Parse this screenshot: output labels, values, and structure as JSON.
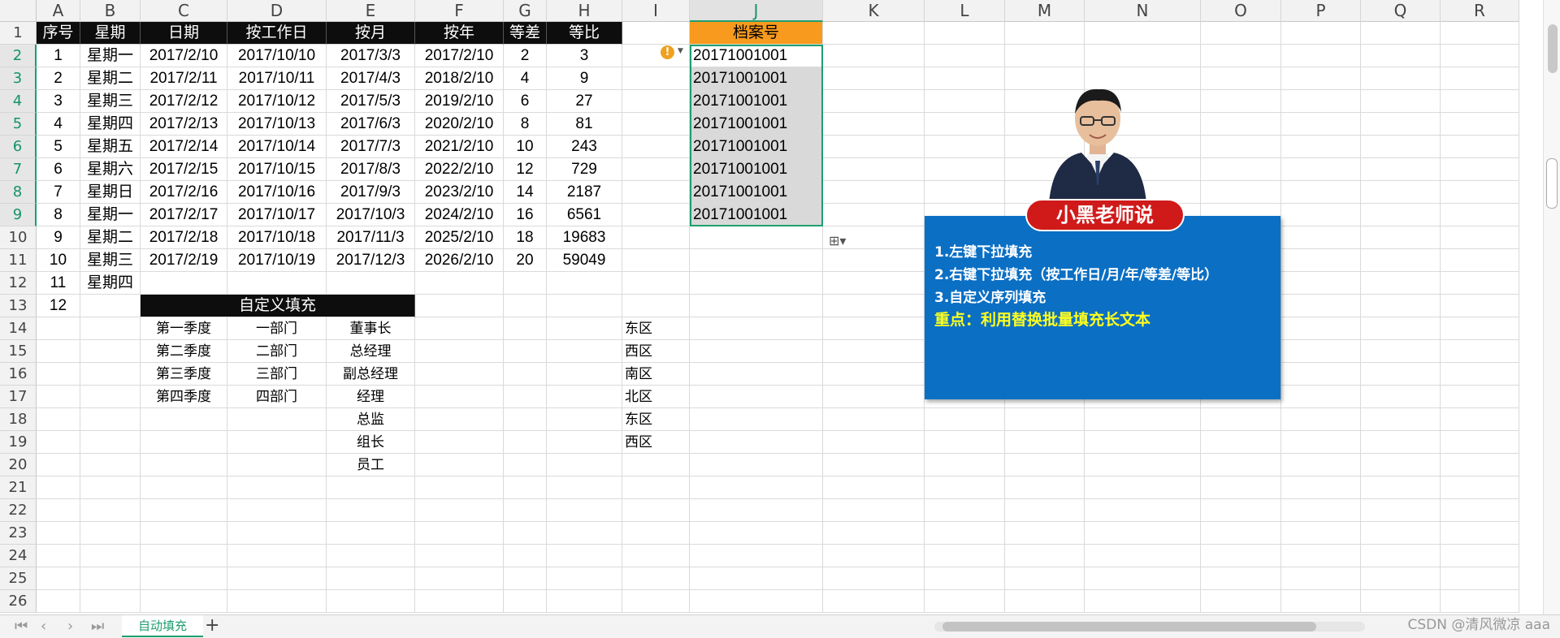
{
  "columns": [
    "A",
    "B",
    "C",
    "D",
    "E",
    "F",
    "G",
    "H",
    "I",
    "J",
    "K",
    "L",
    "M",
    "N",
    "O",
    "P",
    "Q",
    "R"
  ],
  "selected_column": "J",
  "rows": [
    "1",
    "2",
    "3",
    "4",
    "5",
    "6",
    "7",
    "8",
    "9",
    "10",
    "11",
    "12",
    "13",
    "14",
    "15",
    "16",
    "17",
    "18",
    "19",
    "20",
    "21",
    "22",
    "23",
    "24",
    "25",
    "26"
  ],
  "selected_rows": [
    "2",
    "3",
    "4",
    "5",
    "6",
    "7",
    "8",
    "9"
  ],
  "header_row": [
    "序号",
    "星期",
    "日期",
    "按工作日",
    "按月",
    "按年",
    "等差",
    "等比"
  ],
  "j_header": "档案号",
  "table_rows": [
    [
      "1",
      "星期一",
      "2017/2/10",
      "2017/10/10",
      "2017/3/3",
      "2017/2/10",
      "2",
      "3"
    ],
    [
      "2",
      "星期二",
      "2017/2/11",
      "2017/10/11",
      "2017/4/3",
      "2018/2/10",
      "4",
      "9"
    ],
    [
      "3",
      "星期三",
      "2017/2/12",
      "2017/10/12",
      "2017/5/3",
      "2019/2/10",
      "6",
      "27"
    ],
    [
      "4",
      "星期四",
      "2017/2/13",
      "2017/10/13",
      "2017/6/3",
      "2020/2/10",
      "8",
      "81"
    ],
    [
      "5",
      "星期五",
      "2017/2/14",
      "2017/10/14",
      "2017/7/3",
      "2021/2/10",
      "10",
      "243"
    ],
    [
      "6",
      "星期六",
      "2017/2/15",
      "2017/10/15",
      "2017/8/3",
      "2022/2/10",
      "12",
      "729"
    ],
    [
      "7",
      "星期日",
      "2017/2/16",
      "2017/10/16",
      "2017/9/3",
      "2023/2/10",
      "14",
      "2187"
    ],
    [
      "8",
      "星期一",
      "2017/2/17",
      "2017/10/17",
      "2017/10/3",
      "2024/2/10",
      "16",
      "6561"
    ],
    [
      "9",
      "星期二",
      "2017/2/18",
      "2017/10/18",
      "2017/11/3",
      "2025/2/10",
      "18",
      "19683"
    ],
    [
      "10",
      "星期三",
      "2017/2/19",
      "2017/10/19",
      "2017/12/3",
      "2026/2/10",
      "20",
      "59049"
    ],
    [
      "11",
      "星期四",
      "",
      "",
      "",
      "",
      "",
      ""
    ],
    [
      "12",
      "",
      "",
      "",
      "",
      "",
      "",
      ""
    ]
  ],
  "archive_numbers": [
    "20171001001",
    "20171001001",
    "20171001001",
    "20171001001",
    "20171001001",
    "20171001001",
    "20171001001",
    "20171001001"
  ],
  "custom_fill_title": "自定义填充",
  "custom_lists": {
    "quarters": [
      "第一季度",
      "第二季度",
      "第三季度",
      "第四季度"
    ],
    "departments": [
      "一部门",
      "二部门",
      "三部门",
      "四部门"
    ],
    "positions": [
      "董事长",
      "总经理",
      "副总经理",
      "经理",
      "总监",
      "组长",
      "员工"
    ],
    "regions": [
      "东区",
      "西区",
      "南区",
      "北区",
      "东区",
      "西区"
    ]
  },
  "note": {
    "badge": "小黑老师说",
    "line1": "1.左键下拉填充",
    "line2": "2.右键下拉填充（按工作日/月/年/等差/等比）",
    "line3": "3.自定义序列填充",
    "key": "重点：利用替换批量填充长文本"
  },
  "sheet_tab": "自动填充",
  "watermark": "CSDN @清风微凉 aaa",
  "colors": {
    "accent": "#1e9e6e",
    "j_header": "#f79a1e",
    "note_bg": "#0b6fc4",
    "badge": "#d01a1a",
    "key_text": "#ffff1f"
  }
}
